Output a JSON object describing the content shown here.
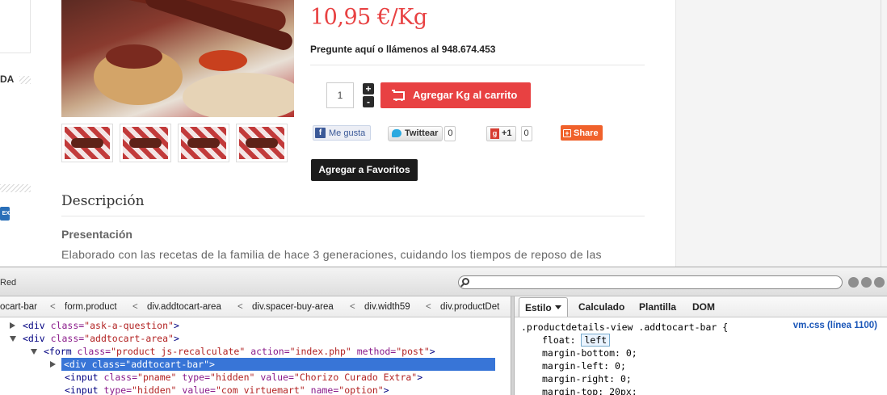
{
  "page": {
    "left_fragment": "DA",
    "card_text": "EX",
    "price": "10,95 €/Kg",
    "ask_line": "Pregunte aquí o llámenos al 948.674.453",
    "quantity": "1",
    "stepper_plus": "+",
    "stepper_minus": "-",
    "cart_button": "Agregar Kg al carrito",
    "social": {
      "fb_icon": "f",
      "fb_label": "Me gusta",
      "tw_label": "Twittear",
      "tw_count": "0",
      "gp_icon": "g",
      "gp_label": "+1",
      "gp_count": "0",
      "share_icon": "+",
      "share_label": "Share"
    },
    "favorites_button": "Agregar a Favoritos",
    "description_heading": "Descripción",
    "presentation_heading": "Presentación",
    "body_text": "Elaborado con las recetas de la familia de hace 3 generaciones, cuidando los tiempos de reposo de las"
  },
  "devtools": {
    "toolbar_label": "Red",
    "search_value": "",
    "breadcrumbs": [
      "ocart-bar",
      "form.product",
      "div.addtocart-area",
      "div.spacer-buy-area",
      "div.width59",
      "div.productDet"
    ],
    "crumb_separator": "<",
    "html_nodes": [
      {
        "tag_open": "<div",
        "attr": " class=",
        "val": "\"ask-a-question\"",
        "tag_close": ">"
      },
      {
        "tag_open": "<div",
        "attr": " class=",
        "val": "\"addtocart-area\"",
        "tag_close": ">"
      },
      {
        "tag_open": "<form",
        "attr": " class=",
        "val": "\"product js-recalculate\"",
        "attr2": " action=",
        "val2": "\"index.php\"",
        "attr3": " method=",
        "val3": "\"post\"",
        "tag_close": ">"
      },
      {
        "tag_open": "<div",
        "attr": " class=",
        "val": "\"addtocart-bar\"",
        "tag_close": ">"
      },
      {
        "tag_open": "<input",
        "attr": " class=",
        "val": "\"pname\"",
        "attr2": " type=",
        "val2": "\"hidden\"",
        "attr3": " value=",
        "val3": "\"Chorizo Curado Extra\"",
        "tag_close": ">"
      },
      {
        "tag_open": "<input",
        "attr": " type=",
        "val": "\"hidden\"",
        "attr2": " value=",
        "val2": "\"com_virtuemart\"",
        "attr3": " name=",
        "val3": "\"option\"",
        "tag_close": ">"
      }
    ],
    "side_tabs": [
      "Estilo",
      "Calculado",
      "Plantilla",
      "DOM"
    ],
    "css_selector": ".productdetails-view .addtocart-bar {",
    "css_source": "vm.css (línea 1100)",
    "css_props": [
      {
        "name": "float",
        "value": "left"
      },
      {
        "name": "margin-bottom",
        "value": "0;"
      },
      {
        "name": "margin-left",
        "value": "0;"
      },
      {
        "name": "margin-right",
        "value": "0;"
      },
      {
        "name": "margin-top",
        "value": "20px;"
      }
    ]
  }
}
